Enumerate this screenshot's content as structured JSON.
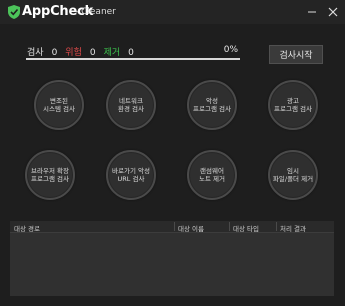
{
  "app": {
    "name": "AppCheck",
    "subtitle": "- Cleaner"
  },
  "window_controls": {
    "minimize": "—",
    "close": "✕"
  },
  "stats": {
    "scan_label": "검사",
    "scan_count": "0",
    "risk_label": "위험",
    "risk_count": "0",
    "removed_label": "제거",
    "removed_count": "0",
    "percent": "0%",
    "progress_fraction": 1.0
  },
  "start_button": "검사시작",
  "scan_items": [
    {
      "label": "변조된\n시스템 검사"
    },
    {
      "label": "네트워크\n환경 검사"
    },
    {
      "label": "악성\n프로그램 검사"
    },
    {
      "label": "광고\n프로그램 검사"
    },
    {
      "label": "브라우저 확장\n프로그램 검사"
    },
    {
      "label": "바로가기 악성\nURL 검사"
    },
    {
      "label": "랜섬웨어\n노트 제거"
    },
    {
      "label": "임시\n파일/폴더 제거"
    }
  ],
  "table": {
    "columns": [
      "대상 경로",
      "대상 이름",
      "대상 타입",
      "처리 결과"
    ],
    "rows": []
  },
  "colors": {
    "background": "#1e1e1e",
    "risk": "#e04a4a",
    "removed": "#3cc04c",
    "logo": "#4cc35a"
  }
}
